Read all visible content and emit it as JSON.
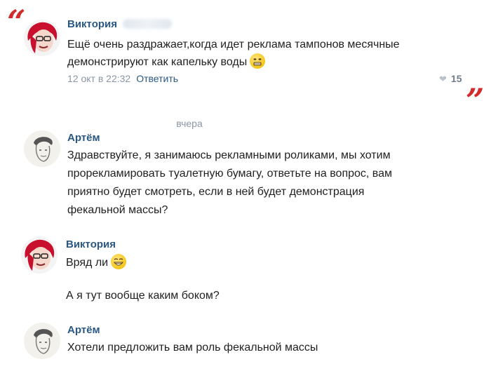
{
  "decor": {
    "quote_open": "“",
    "quote_close": "”"
  },
  "post": {
    "author": "Виктория",
    "line1": "Ещё очень раздражает,когда идет реклама тампонов месячные",
    "line2": "демонстрируют как капельку воды",
    "timestamp": "12 окт в 22:32",
    "reply_label": "Ответить",
    "likes": "15"
  },
  "chat": {
    "date_separator": "вчера",
    "messages": [
      {
        "author": "Артём",
        "lines": [
          "Здравствуйте, я занимаюсь рекламными роликами, мы хотим",
          "прорекламировать туалетную бумагу, ответьте на вопрос, вам",
          "приятно будет смотреть, если в ней будет демонстрация",
          "фекальной массы?"
        ]
      },
      {
        "author": "Виктория",
        "lines": [
          "Вряд ли"
        ],
        "extra": "А я тут вообще каким боком?"
      },
      {
        "author": "Артём",
        "lines": [
          "Хотели предложить вам роль фекальной массы"
        ]
      }
    ]
  },
  "icons": {
    "heart": "heart-icon",
    "emoji_grimace": "grimace-emoji-icon",
    "emoji_grin": "grin-emoji-icon"
  },
  "colors": {
    "link": "#2a5885",
    "meta": "#8a96a3",
    "quote": "#d12b2b"
  }
}
